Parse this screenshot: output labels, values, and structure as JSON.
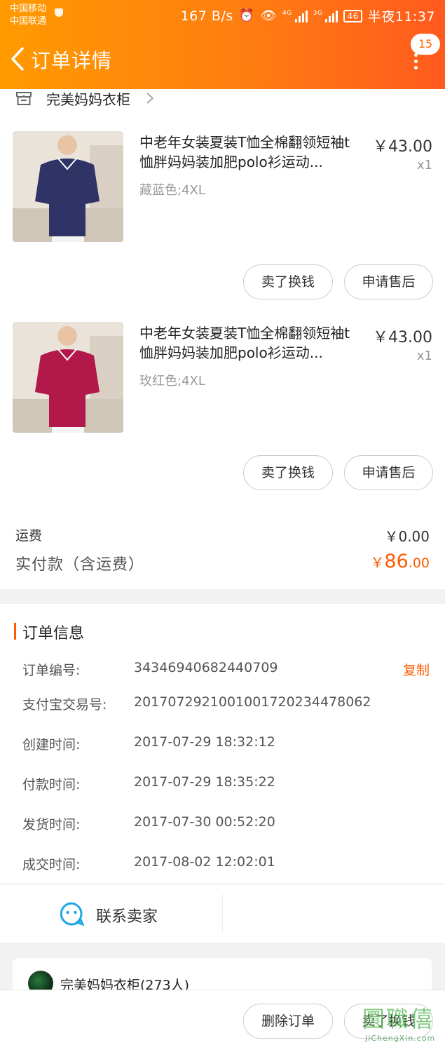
{
  "status_bar": {
    "carrier_1": "中国移动",
    "carrier_2": "中国联通",
    "speed": "167 B/s",
    "net_1": "4G",
    "net_2": "3G",
    "battery": "46",
    "time": "半夜11:37"
  },
  "header": {
    "title": "订单详情",
    "badge": "15"
  },
  "shop": {
    "name": "完美妈妈衣柜"
  },
  "products": [
    {
      "title": "中老年女装夏装T恤全棉翻领短袖t恤胖妈妈装加肥polo衫运动...",
      "price": "￥43.00",
      "qty": "x1",
      "sku": "藏蓝色;4XL",
      "color": "#2f3366",
      "btn_resell": "卖了换钱",
      "btn_aftersale": "申请售后"
    },
    {
      "title": "中老年女装夏装T恤全棉翻领短袖t恤胖妈妈装加肥polo衫运动...",
      "price": "￥43.00",
      "qty": "x1",
      "sku": "玫红色;4XL",
      "color": "#b2184a",
      "btn_resell": "卖了换钱",
      "btn_aftersale": "申请售后"
    }
  ],
  "summary": {
    "shipping_label": "运费",
    "shipping_value": "￥0.00",
    "paid_label": "实付款（含运费）",
    "paid_currency": "￥",
    "paid_int": "86",
    "paid_dec": ".00"
  },
  "order_info": {
    "title": "订单信息",
    "copy_label": "复制",
    "rows": [
      {
        "key": "订单编号:",
        "value": "34346940682440709"
      },
      {
        "key": "支付宝交易号:",
        "value": "2017072921001001720234478062"
      },
      {
        "key": "创建时间:",
        "value": "2017-07-29 18:32:12"
      },
      {
        "key": "付款时间:",
        "value": "2017-07-29 18:35:22"
      },
      {
        "key": "发货时间:",
        "value": "2017-07-30 00:52:20"
      },
      {
        "key": "成交时间:",
        "value": "2017-08-02 12:02:01"
      }
    ]
  },
  "contact": {
    "label": "联系卖家"
  },
  "group": {
    "name": "完美妈妈衣柜(273人)"
  },
  "bottom_bar": {
    "delete_label": "删除订单",
    "resell_label": "卖了换钱"
  },
  "watermark": {
    "logo": "圜職僖",
    "url": "JiChengXin.com"
  },
  "colors": {
    "accent": "#ff5a00",
    "header_start": "#ff9a00",
    "header_end": "#ff5a1e",
    "contact_icon": "#1fa7e6"
  }
}
